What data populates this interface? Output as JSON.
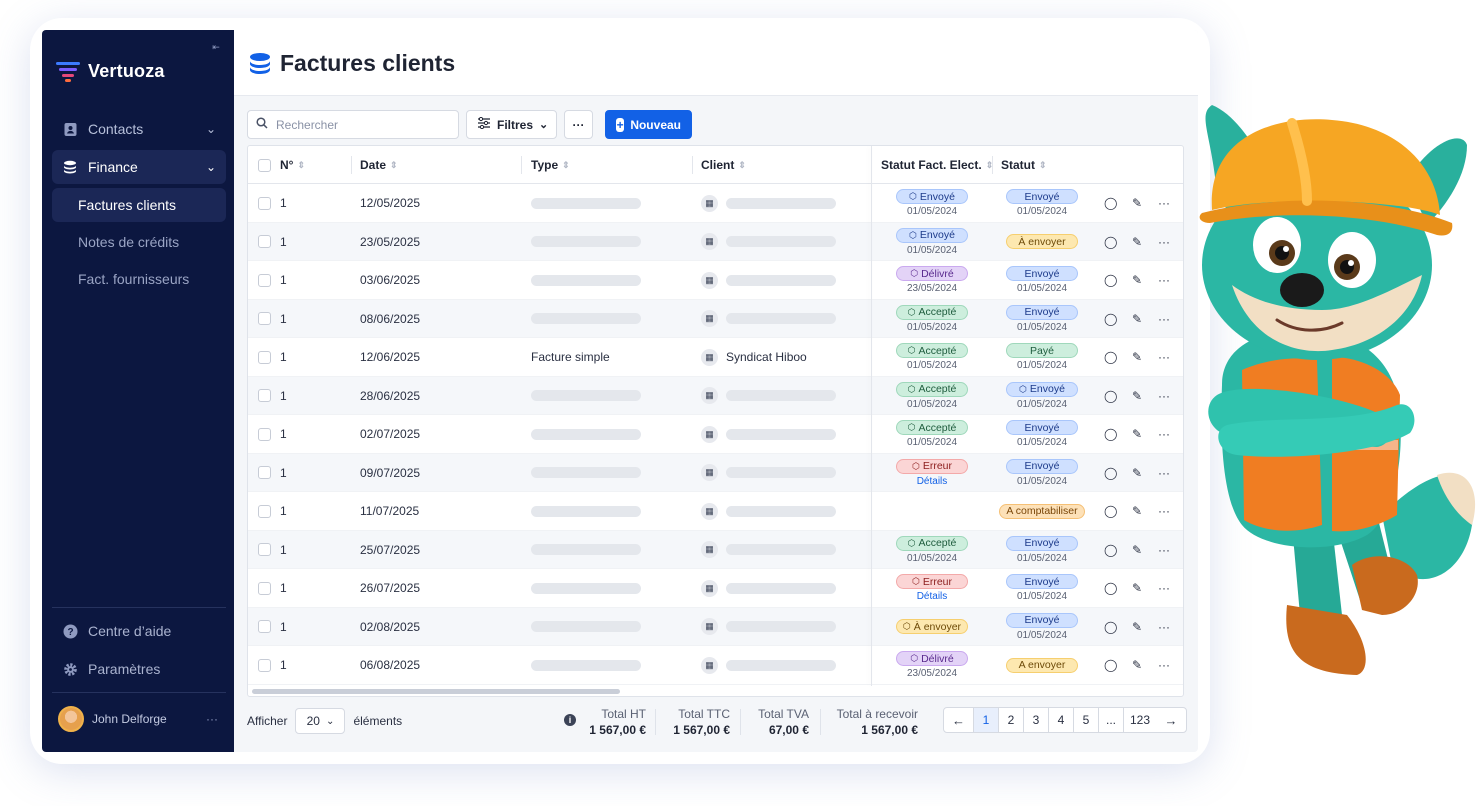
{
  "brand": {
    "name": "Vertuoza"
  },
  "sidebar": {
    "items": [
      {
        "label": "Contacts",
        "icon": "contact-book-icon"
      },
      {
        "label": "Finance",
        "icon": "coins-stack-icon"
      }
    ],
    "sub_items": [
      {
        "label": "Factures clients"
      },
      {
        "label": "Notes de crédits"
      },
      {
        "label": "Fact. fournisseurs"
      }
    ],
    "bottom": [
      {
        "label": "Centre d’aide",
        "icon": "help-icon"
      },
      {
        "label": "Paramètres",
        "icon": "gear-icon"
      }
    ],
    "user": {
      "name": "John Delforge"
    }
  },
  "header": {
    "title": "Factures clients"
  },
  "toolbar": {
    "search_placeholder": "Rechercher",
    "filters_label": "Filtres",
    "more_label": "···",
    "new_label": "Nouveau"
  },
  "table": {
    "columns": [
      "N°",
      "Date",
      "Type",
      "Client",
      "Statut Fact. Elect.",
      "Statut"
    ],
    "rows": [
      {
        "num": "1",
        "date": "12/05/2025",
        "type": "",
        "client": "",
        "fe": {
          "label": "Envoyé",
          "kind": "blue",
          "sub": "01/05/2024"
        },
        "st": {
          "label": "Envoyé",
          "kind": "blue",
          "sub": "01/05/2024"
        }
      },
      {
        "num": "1",
        "date": "23/05/2025",
        "type": "",
        "client": "",
        "fe": {
          "label": "Envoyé",
          "kind": "blue",
          "sub": "01/05/2024"
        },
        "st": {
          "label": "À envoyer",
          "kind": "yellow",
          "sub": ""
        }
      },
      {
        "num": "1",
        "date": "03/06/2025",
        "type": "",
        "client": "",
        "fe": {
          "label": "Délivré",
          "kind": "purple",
          "sub": "23/05/2024"
        },
        "st": {
          "label": "Envoyé",
          "kind": "blue",
          "sub": "01/05/2024"
        }
      },
      {
        "num": "1",
        "date": "08/06/2025",
        "type": "",
        "client": "",
        "fe": {
          "label": "Accepté",
          "kind": "green",
          "sub": "01/05/2024"
        },
        "st": {
          "label": "Envoyé",
          "kind": "blue",
          "sub": "01/05/2024"
        }
      },
      {
        "num": "1",
        "date": "12/06/2025",
        "type": "Facture simple",
        "client": "Syndicat Hiboo",
        "fe": {
          "label": "Accepté",
          "kind": "green",
          "sub": "01/05/2024"
        },
        "st": {
          "label": "Payé",
          "kind": "green",
          "sub": "01/05/2024"
        }
      },
      {
        "num": "1",
        "date": "28/06/2025",
        "type": "",
        "client": "",
        "fe": {
          "label": "Accepté",
          "kind": "green",
          "sub": "01/05/2024"
        },
        "st": {
          "label": "Envoyé",
          "kind": "blue",
          "sub": "01/05/2024",
          "icon": true
        }
      },
      {
        "num": "1",
        "date": "02/07/2025",
        "type": "",
        "client": "",
        "fe": {
          "label": "Accepté",
          "kind": "green",
          "sub": "01/05/2024"
        },
        "st": {
          "label": "Envoyé",
          "kind": "blue",
          "sub": "01/05/2024"
        }
      },
      {
        "num": "1",
        "date": "09/07/2025",
        "type": "",
        "client": "",
        "fe": {
          "label": "Erreur",
          "kind": "red",
          "link": "Détails"
        },
        "st": {
          "label": "Envoyé",
          "kind": "blue",
          "sub": "01/05/2024"
        }
      },
      {
        "num": "1",
        "date": "11/07/2025",
        "type": "",
        "client": "",
        "fe": null,
        "st": {
          "label": "A comptabiliser",
          "kind": "orange",
          "sub": ""
        }
      },
      {
        "num": "1",
        "date": "25/07/2025",
        "type": "",
        "client": "",
        "fe": {
          "label": "Accepté",
          "kind": "green",
          "sub": "01/05/2024"
        },
        "st": {
          "label": "Envoyé",
          "kind": "blue",
          "sub": "01/05/2024"
        }
      },
      {
        "num": "1",
        "date": "26/07/2025",
        "type": "",
        "client": "",
        "fe": {
          "label": "Erreur",
          "kind": "red",
          "link": "Détails"
        },
        "st": {
          "label": "Envoyé",
          "kind": "blue",
          "sub": "01/05/2024"
        }
      },
      {
        "num": "1",
        "date": "02/08/2025",
        "type": "",
        "client": "",
        "fe": {
          "label": "À envoyer",
          "kind": "yellow",
          "sub": ""
        },
        "st": {
          "label": "Envoyé",
          "kind": "blue",
          "sub": "01/05/2024"
        }
      },
      {
        "num": "1",
        "date": "06/08/2025",
        "type": "",
        "client": "",
        "fe": {
          "label": "Délivré",
          "kind": "purple",
          "sub": "23/05/2024"
        },
        "st": {
          "label": "A envoyer",
          "kind": "yellow",
          "sub": ""
        }
      }
    ]
  },
  "footer": {
    "show_label": "Afficher",
    "page_size": "20",
    "elements_label": "éléments",
    "totals": [
      {
        "label": "Total HT",
        "value": "1 567,00 €"
      },
      {
        "label": "Total TTC",
        "value": "1 567,00 €"
      },
      {
        "label": "Total TVA",
        "value": "67,00 €"
      },
      {
        "label": "Total à recevoir",
        "value": "1 567,00 €"
      }
    ],
    "pages": [
      "1",
      "2",
      "3",
      "4",
      "5",
      "...",
      "123"
    ],
    "current_page": "1"
  },
  "colors": {
    "sidebar_bg": "#0c1740",
    "primary": "#1261e6"
  }
}
